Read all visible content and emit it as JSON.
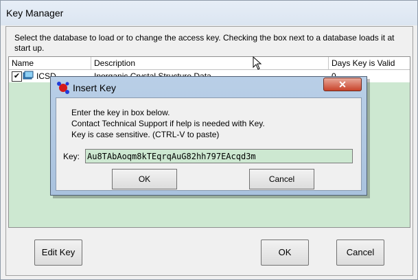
{
  "window": {
    "title": "Key Manager"
  },
  "instructions": "Select the database to load or to change the access key.  Checking the box next to a database loads it at start up.",
  "grid": {
    "columns": [
      "Name",
      "Description",
      "Days Key is Valid"
    ],
    "rows": [
      {
        "checked": true,
        "name": "ICSD",
        "description": "Inorganic Crystal Structure Data",
        "days": "0"
      }
    ]
  },
  "buttons": {
    "edit_key": "Edit Key",
    "ok": "OK",
    "cancel": "Cancel"
  },
  "dialog": {
    "title": "Insert Key",
    "close_glyph": "✕",
    "lines": [
      "Enter the key in box below.",
      "Contact Technical Support if help is needed with Key.",
      "Key is case sensitive.  (CTRL-V to paste)"
    ],
    "key_label": "Key:",
    "key_value": "Au8TAbAoqm8kTEqrqAuG82hh797EAcqd3m",
    "ok": "OK",
    "cancel": "Cancel"
  }
}
